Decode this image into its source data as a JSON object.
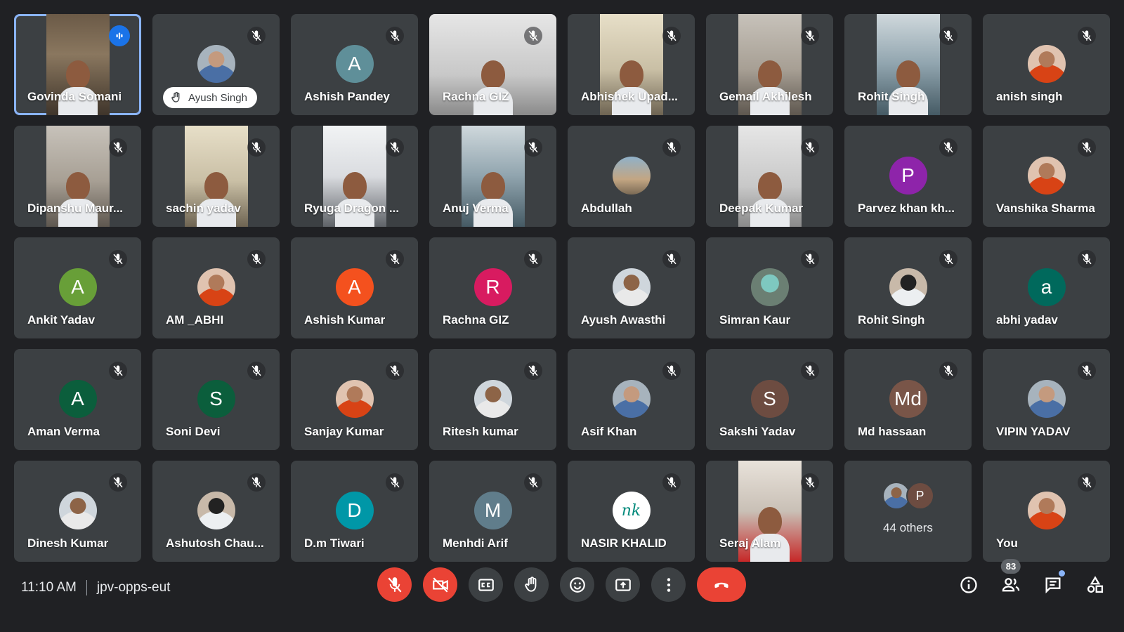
{
  "participants": [
    {
      "name": "Govinda Somani",
      "display": "video",
      "cam": "cam1",
      "speaking": true,
      "active": true
    },
    {
      "name": "Ayush Singh",
      "display": "avatar",
      "avatar": "photo",
      "hand_raised": true
    },
    {
      "name": "Ashish Pandey",
      "display": "avatar",
      "initial": "A",
      "color": "#5f8f99"
    },
    {
      "name": "Rachna GIZ",
      "display": "video",
      "cam": "cam5",
      "full": true
    },
    {
      "name": "Abhishek Upad...",
      "display": "video",
      "cam": "cam3"
    },
    {
      "name": "Gemail Akhilesh",
      "display": "video",
      "cam": "cam4"
    },
    {
      "name": "Rohit Singh",
      "display": "video",
      "cam": "cam6"
    },
    {
      "name": "anish singh",
      "display": "avatar",
      "avatar": "photo p3"
    },
    {
      "name": "Dipanshu Maur...",
      "display": "video",
      "cam": "cam4"
    },
    {
      "name": "sachin yadav",
      "display": "video",
      "cam": "cam3"
    },
    {
      "name": "Ryuga Dragon ...",
      "display": "video",
      "cam": "cam2"
    },
    {
      "name": "Anuj Verma",
      "display": "video",
      "cam": "cam6"
    },
    {
      "name": "Abdullah",
      "display": "avatar",
      "avatar": "photo p4"
    },
    {
      "name": "Deepak Kumar",
      "display": "video",
      "cam": "cam5"
    },
    {
      "name": "Parvez khan kh...",
      "display": "avatar",
      "initial": "P",
      "color": "#8e24aa"
    },
    {
      "name": "Vanshika Sharma",
      "display": "avatar",
      "avatar": "photo p3"
    },
    {
      "name": "Ankit Yadav",
      "display": "avatar",
      "initial": "A",
      "color": "#689f38"
    },
    {
      "name": "AM _ABHI",
      "display": "avatar",
      "avatar": "photo p3"
    },
    {
      "name": "Ashish Kumar",
      "display": "avatar",
      "initial": "A",
      "color": "#f4511e"
    },
    {
      "name": "Rachna GIZ",
      "display": "avatar",
      "initial": "R",
      "color": "#d81b60"
    },
    {
      "name": "Ayush Awasthi",
      "display": "avatar",
      "avatar": "photo p2"
    },
    {
      "name": "Simran Kaur",
      "display": "avatar",
      "avatar": "photo p5"
    },
    {
      "name": "Rohit Singh",
      "display": "avatar",
      "avatar": "photo p6"
    },
    {
      "name": "abhi yadav",
      "display": "avatar",
      "initial": "a",
      "color": "#00695c"
    },
    {
      "name": "Aman Verma",
      "display": "avatar",
      "initial": "A",
      "color": "#0b5e3c"
    },
    {
      "name": "Soni Devi",
      "display": "avatar",
      "initial": "S",
      "color": "#0b5e3c"
    },
    {
      "name": "Sanjay Kumar",
      "display": "avatar",
      "avatar": "photo p3"
    },
    {
      "name": "Ritesh kumar",
      "display": "avatar",
      "avatar": "photo p2"
    },
    {
      "name": "Asif Khan",
      "display": "avatar",
      "avatar": "photo"
    },
    {
      "name": "Sakshi Yadav",
      "display": "avatar",
      "initial": "S",
      "color": "#6d4c41"
    },
    {
      "name": "Md hassaan",
      "display": "avatar",
      "initial": "Md",
      "color": "#795548"
    },
    {
      "name": "VIPIN YADAV",
      "display": "avatar",
      "avatar": "photo"
    },
    {
      "name": "Dinesh Kumar",
      "display": "avatar",
      "avatar": "photo p2"
    },
    {
      "name": "Ashutosh Chau...",
      "display": "avatar",
      "avatar": "photo p6"
    },
    {
      "name": "D.m Tiwari",
      "display": "avatar",
      "initial": "D",
      "color": "#0097a7"
    },
    {
      "name": "Menhdi Arif",
      "display": "avatar",
      "initial": "M",
      "color": "#607d8b"
    },
    {
      "name": "NASIR KHALID",
      "display": "avatar",
      "avatar": "logo",
      "logo_text": "nk"
    },
    {
      "name": "Seraj Alam",
      "display": "video",
      "cam": "cam7"
    },
    {
      "name": "",
      "display": "others",
      "others_label": "44 others",
      "mini_initial": "P",
      "mini_color": "#6d4c41"
    },
    {
      "name": "You",
      "display": "avatar",
      "avatar": "photo p3"
    }
  ],
  "bottom_bar": {
    "time": "11:10 AM",
    "meeting_code": "jpv-opps-eut",
    "participant_count": "83"
  },
  "colors": {
    "background": "#202124",
    "tile": "#3c4043",
    "danger": "#ea4335",
    "accent": "#8ab4f8",
    "speaking": "#1a73e8"
  },
  "icons": {
    "tile_mic": "mic-off-icon",
    "controls": [
      "mic-off-icon",
      "camera-off-icon",
      "captions-icon",
      "raise-hand-icon",
      "emoji-icon",
      "present-screen-icon",
      "more-options-icon",
      "end-call-icon"
    ],
    "right": [
      "info-icon",
      "people-icon",
      "chat-icon",
      "activities-icon"
    ]
  }
}
